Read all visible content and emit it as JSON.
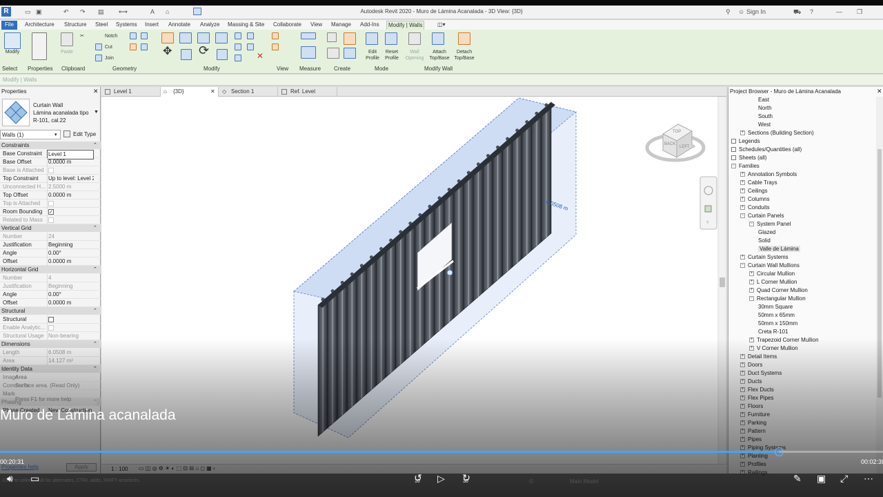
{
  "app": {
    "title": "Autodesk Revit 2020 - Muro de Lámina Acanalada - 3D View: {3D}",
    "sign_in": "Sign In"
  },
  "ribbon_tabs": [
    "File",
    "Architecture",
    "Structure",
    "Steel",
    "Systems",
    "Insert",
    "Annotate",
    "Analyze",
    "Massing & Site",
    "Collaborate",
    "View",
    "Manage",
    "Add-Ins",
    "Modify | Walls"
  ],
  "ribbon": {
    "modify": "Modify",
    "paste": "Paste",
    "notch": "Notch",
    "cut": "Cut",
    "join": "Join",
    "edit_profile": "Edit Profile",
    "reset_profile": "Reset Profile",
    "wall_opening": "Wall Opening",
    "attach": "Attach Top/Base",
    "detach": "Detach Top/Base",
    "panels": [
      "Select",
      "Properties",
      "Clipboard",
      "Geometry",
      "Modify",
      "View",
      "Measure",
      "Create",
      "Mode",
      "Modify Wall"
    ]
  },
  "options_bar": "Modify | Walls",
  "properties": {
    "title": "Properties",
    "family": "Curtain Wall",
    "type_line1": "Lámina acanalada tipo",
    "type_line2": "R-101, cal.22",
    "selector": "Walls (1)",
    "edit_type": "Edit Type",
    "sections": [
      {
        "name": "Constraints",
        "rows": [
          {
            "k": "Base Constraint",
            "v": "Level 1",
            "dim": false
          },
          {
            "k": "Base Offset",
            "v": "0.0000 m",
            "dim": false
          },
          {
            "k": "Base is Attached",
            "v": "",
            "dim": true,
            "cb": "empty"
          },
          {
            "k": "Top Constraint",
            "v": "Up to level: Level 2",
            "dim": false
          },
          {
            "k": "Unconnected H...",
            "v": "2.5000 m",
            "dim": true
          },
          {
            "k": "Top Offset",
            "v": "0.0000 m",
            "dim": false
          },
          {
            "k": "Top is Attached",
            "v": "",
            "dim": true,
            "cb": "empty"
          },
          {
            "k": "Room Bounding",
            "v": "",
            "dim": false,
            "cb": "checked"
          },
          {
            "k": "Related to Mass",
            "v": "",
            "dim": true,
            "cb": "empty"
          }
        ]
      },
      {
        "name": "Vertical Grid",
        "rows": [
          {
            "k": "Number",
            "v": "24",
            "dim": true
          },
          {
            "k": "Justification",
            "v": "Beginning",
            "dim": false
          },
          {
            "k": "Angle",
            "v": "0.00°",
            "dim": false
          },
          {
            "k": "Offset",
            "v": "0.0000 m",
            "dim": false
          }
        ]
      },
      {
        "name": "Horizontal Grid",
        "rows": [
          {
            "k": "Number",
            "v": "4",
            "dim": true
          },
          {
            "k": "Justification",
            "v": "Beginning",
            "dim": true
          },
          {
            "k": "Angle",
            "v": "0.00°",
            "dim": false
          },
          {
            "k": "Offset",
            "v": "0.0000 m",
            "dim": false
          }
        ]
      },
      {
        "name": "Structural",
        "rows": [
          {
            "k": "Structural",
            "v": "",
            "dim": false,
            "cb": "empty"
          },
          {
            "k": "Enable Analytic...",
            "v": "",
            "dim": true,
            "cb": "empty"
          },
          {
            "k": "Structural Usage",
            "v": "Non-bearing",
            "dim": true
          }
        ]
      },
      {
        "name": "Dimensions",
        "rows": [
          {
            "k": "Length",
            "v": "6.0508 m",
            "dim": true
          },
          {
            "k": "Area",
            "v": "14.127 m²",
            "dim": true
          }
        ]
      },
      {
        "name": "Identity Data",
        "rows": [
          {
            "k": "Image",
            "v": "",
            "dim": false
          },
          {
            "k": "Comments",
            "v": "",
            "dim": false
          },
          {
            "k": "Mark",
            "v": "",
            "dim": false
          }
        ]
      },
      {
        "name": "Phasing",
        "rows": [
          {
            "k": "Phase Created",
            "v": "New Construction",
            "dim": false
          }
        ]
      }
    ],
    "tooltip_title": "Area",
    "tooltip_text": "Surface area. (Read Only)",
    "tooltip_help": "Press F1 for more help",
    "help_link": "Properties help",
    "apply": "Apply"
  },
  "view_tabs": [
    "Level 1",
    "{3D}",
    "Section 1",
    "Ref. Level"
  ],
  "viewport": {
    "dim_label": "0.0508 m",
    "view_cube_top": "TOP",
    "view_cube_back": "BACK",
    "view_cube_left": "LEFT",
    "scale": "1 : 100",
    "main_model": "Main Model",
    "zero": ":0"
  },
  "browser": {
    "title": "Project Browser - Muro de Lámina Acanalada",
    "items": [
      {
        "t": "East",
        "lvl": 3,
        "tog": ""
      },
      {
        "t": "North",
        "lvl": 3,
        "tog": ""
      },
      {
        "t": "South",
        "lvl": 3,
        "tog": ""
      },
      {
        "t": "West",
        "lvl": 3,
        "tog": ""
      },
      {
        "t": "Sections (Building Section)",
        "lvl": 1,
        "tog": "+"
      },
      {
        "t": "Legends",
        "lvl": 0,
        "tog": "icon"
      },
      {
        "t": "Schedules/Quantities (all)",
        "lvl": 0,
        "tog": "icon"
      },
      {
        "t": "Sheets (all)",
        "lvl": 0,
        "tog": "icon"
      },
      {
        "t": "Families",
        "lvl": 0,
        "tog": "-"
      },
      {
        "t": "Annotation Symbols",
        "lvl": 1,
        "tog": "+"
      },
      {
        "t": "Cable Trays",
        "lvl": 1,
        "tog": "+"
      },
      {
        "t": "Ceilings",
        "lvl": 1,
        "tog": "+"
      },
      {
        "t": "Columns",
        "lvl": 1,
        "tog": "+"
      },
      {
        "t": "Conduits",
        "lvl": 1,
        "tog": "+"
      },
      {
        "t": "Curtain Panels",
        "lvl": 1,
        "tog": "-"
      },
      {
        "t": "System Panel",
        "lvl": 2,
        "tog": "-"
      },
      {
        "t": "Glazed",
        "lvl": 3,
        "tog": ""
      },
      {
        "t": "Solid",
        "lvl": 3,
        "tog": ""
      },
      {
        "t": "Valle de Lámina",
        "lvl": 3,
        "tog": "",
        "sel": true
      },
      {
        "t": "Curtain Systems",
        "lvl": 1,
        "tog": "+"
      },
      {
        "t": "Curtain Wall Mullions",
        "lvl": 1,
        "tog": "-"
      },
      {
        "t": "Circular Mullion",
        "lvl": 2,
        "tog": "+"
      },
      {
        "t": "L Corner Mullion",
        "lvl": 2,
        "tog": "+"
      },
      {
        "t": "Quad Corner Mullion",
        "lvl": 2,
        "tog": "+"
      },
      {
        "t": "Rectangular Mullion",
        "lvl": 2,
        "tog": "-"
      },
      {
        "t": "30mm Square",
        "lvl": 3,
        "tog": ""
      },
      {
        "t": "50mm x 65mm",
        "lvl": 3,
        "tog": ""
      },
      {
        "t": "50mm x 150mm",
        "lvl": 3,
        "tog": ""
      },
      {
        "t": "Creta R-101",
        "lvl": 3,
        "tog": ""
      },
      {
        "t": "Trapezoid Corner Mullion",
        "lvl": 2,
        "tog": "+"
      },
      {
        "t": "V Corner Mullion",
        "lvl": 2,
        "tog": "+"
      },
      {
        "t": "Detail Items",
        "lvl": 1,
        "tog": "+"
      },
      {
        "t": "Doors",
        "lvl": 1,
        "tog": "+"
      },
      {
        "t": "Duct Systems",
        "lvl": 1,
        "tog": "+"
      },
      {
        "t": "Ducts",
        "lvl": 1,
        "tog": "+"
      },
      {
        "t": "Flex Ducts",
        "lvl": 1,
        "tog": "+"
      },
      {
        "t": "Flex Pipes",
        "lvl": 1,
        "tog": "+"
      },
      {
        "t": "Floors",
        "lvl": 1,
        "tog": "+"
      },
      {
        "t": "Furniture",
        "lvl": 1,
        "tog": "+"
      },
      {
        "t": "Parking",
        "lvl": 1,
        "tog": "+"
      },
      {
        "t": "Pattern",
        "lvl": 1,
        "tog": "+"
      },
      {
        "t": "Pipes",
        "lvl": 1,
        "tog": "+"
      },
      {
        "t": "Piping Systems",
        "lvl": 1,
        "tog": "+"
      },
      {
        "t": "Planting",
        "lvl": 1,
        "tog": "+"
      },
      {
        "t": "Profiles",
        "lvl": 1,
        "tog": "+"
      },
      {
        "t": "Railings",
        "lvl": 1,
        "tog": "+"
      }
    ]
  },
  "status_bar": "Click to select, TAB for alternates, CTRL adds, SHIFT unselects.",
  "video": {
    "title": "Muro de Lámina acanalada",
    "current_time": "00:20:31",
    "duration": "00:02:38",
    "progress": 0.882,
    "skip_back": "10",
    "skip_fwd": "30"
  },
  "colors": {
    "accent": "#3ea6ff",
    "ribbon": "#e5f1dc",
    "file_tab": "#2f6fbf",
    "wall_blue": "#4a6fa8"
  }
}
